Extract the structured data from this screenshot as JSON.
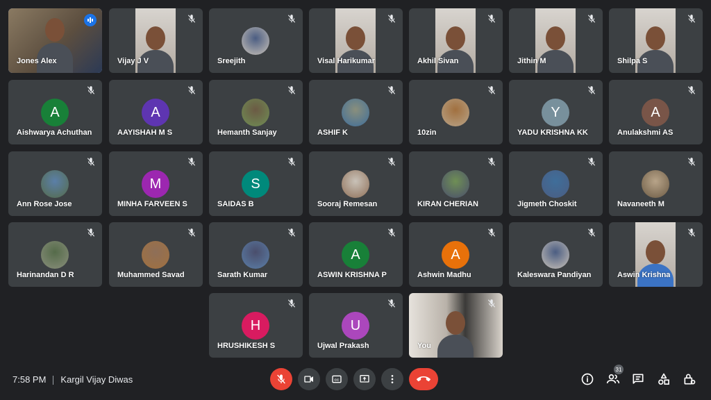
{
  "participants": [
    {
      "name": "Jones Alex",
      "type": "video",
      "speaking": true
    },
    {
      "name": "Vijay J V",
      "type": "video"
    },
    {
      "name": "Sreejith",
      "type": "photo-avatar"
    },
    {
      "name": "Visal Harikumar",
      "type": "video"
    },
    {
      "name": "Akhil Sivan",
      "type": "video"
    },
    {
      "name": "Jithin M",
      "type": "video"
    },
    {
      "name": "Shilpa S",
      "type": "video"
    },
    {
      "name": "Aishwarya Achuthan",
      "type": "letter",
      "letter": "A",
      "color": "#188038"
    },
    {
      "name": "AAYISHAH M S",
      "type": "letter",
      "letter": "A",
      "color": "#5e35b1"
    },
    {
      "name": "Hemanth Sanjay",
      "type": "photo-avatar"
    },
    {
      "name": "ASHIF K",
      "type": "photo-avatar"
    },
    {
      "name": "10zin",
      "type": "photo-avatar"
    },
    {
      "name": "YADU KRISHNA KK",
      "type": "letter",
      "letter": "Y",
      "color": "#78909c"
    },
    {
      "name": "Anulakshmi AS",
      "type": "letter",
      "letter": "A",
      "color": "#795548"
    },
    {
      "name": "Ann Rose Jose",
      "type": "photo-avatar"
    },
    {
      "name": "MINHA FARVEEN S",
      "type": "letter",
      "letter": "M",
      "color": "#9c27b0"
    },
    {
      "name": "SAIDAS B",
      "type": "letter",
      "letter": "S",
      "color": "#00897b"
    },
    {
      "name": "Sooraj Remesan",
      "type": "photo-avatar"
    },
    {
      "name": "KIRAN CHERIAN",
      "type": "photo-avatar"
    },
    {
      "name": "Jigmeth Choskit",
      "type": "photo-avatar"
    },
    {
      "name": "Navaneeth M",
      "type": "photo-avatar"
    },
    {
      "name": "Harinandan D R",
      "type": "photo-avatar"
    },
    {
      "name": "Muhammed Savad",
      "type": "photo-avatar"
    },
    {
      "name": "Sarath Kumar",
      "type": "photo-avatar"
    },
    {
      "name": "ASWIN KRISHNA P",
      "type": "letter",
      "letter": "A",
      "color": "#188038"
    },
    {
      "name": "Ashwin Madhu",
      "type": "letter",
      "letter": "A",
      "color": "#e8710a"
    },
    {
      "name": "Kaleswara Pandiyan",
      "type": "photo-avatar"
    },
    {
      "name": "Aswin Krishna",
      "type": "video"
    },
    {
      "name": "HRUSHIKESH S",
      "type": "letter",
      "letter": "H",
      "color": "#d81b60"
    },
    {
      "name": "Ujwal Prakash",
      "type": "letter",
      "letter": "U",
      "color": "#ab47bc"
    },
    {
      "name": "You",
      "type": "video"
    }
  ],
  "bottom_bar": {
    "time": "7:58 PM",
    "meeting_title": "Kargil Vijay Diwas",
    "people_count": "31",
    "controls": [
      "mic-off-icon",
      "camera-icon",
      "captions-icon",
      "present-icon",
      "more-options-icon",
      "end-call-icon"
    ],
    "right_icons": [
      "info-icon",
      "people-icon",
      "chat-icon",
      "activities-icon",
      "host-controls-icon"
    ]
  },
  "colors": {
    "background": "#202124",
    "tile": "#3c4043",
    "end_call": "#ea4335",
    "accent": "#8ab4f8"
  }
}
